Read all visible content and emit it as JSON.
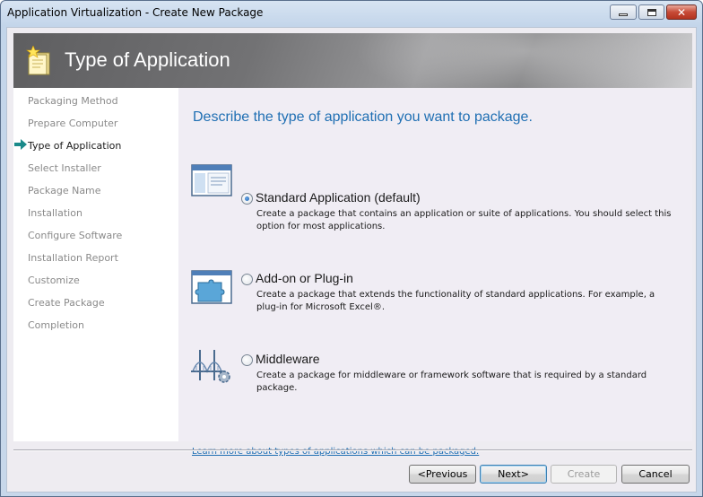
{
  "window": {
    "title": "Application Virtualization - Create New Package"
  },
  "banner": {
    "title": "Type of Application",
    "icon": "package-wizard-icon"
  },
  "nav": {
    "items": [
      {
        "label": "Packaging Method"
      },
      {
        "label": "Prepare Computer"
      },
      {
        "label": "Type of Application"
      },
      {
        "label": "Select Installer"
      },
      {
        "label": "Package Name"
      },
      {
        "label": "Installation"
      },
      {
        "label": "Configure Software"
      },
      {
        "label": "Installation Report"
      },
      {
        "label": "Customize"
      },
      {
        "label": "Create Package"
      },
      {
        "label": "Completion"
      }
    ],
    "current_index": 2
  },
  "main": {
    "heading": "Describe the type of application you want to package.",
    "options": [
      {
        "title": "Standard Application (default)",
        "description": "Create a package that contains an application or suite of applications. You should select this option for most applications.",
        "icon": "standard-application-icon",
        "selected": true
      },
      {
        "title": "Add-on or Plug-in",
        "description": "Create a package that extends the functionality of standard applications. For example, a plug-in for Microsoft Excel®.",
        "icon": "puzzle-piece-icon",
        "selected": false
      },
      {
        "title": "Middleware",
        "description": "Create a package for middleware or framework software that is required by a standard package.",
        "icon": "bridge-gear-icon",
        "selected": false
      }
    ],
    "learn_link": "Learn more about types of applications which can be packaged."
  },
  "buttons": {
    "previous": "<Previous",
    "next": "Next>",
    "create": "Create",
    "cancel": "Cancel"
  },
  "colors": {
    "heading": "#1f6fb3",
    "nav_inactive": "#8a8a8a",
    "content_bg": "#f0edf4"
  }
}
